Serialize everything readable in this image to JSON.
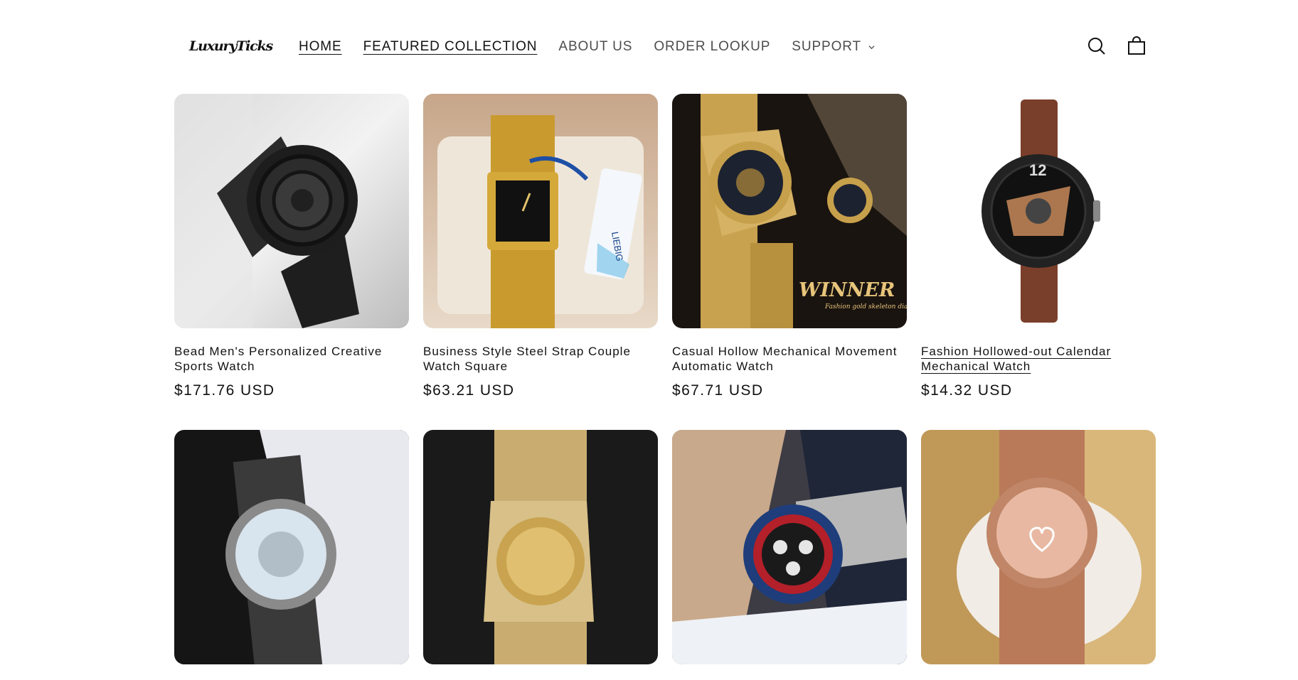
{
  "header": {
    "logo": "LuxuryTicks",
    "nav": [
      {
        "label": "HOME",
        "active": true
      },
      {
        "label": "FEATURED COLLECTION",
        "active": true
      },
      {
        "label": "ABOUT US",
        "active": false
      },
      {
        "label": "ORDER LOOKUP",
        "active": false
      },
      {
        "label": "SUPPORT",
        "active": false
      }
    ],
    "icons": [
      "search-icon",
      "cart-icon",
      "chevron-down-icon"
    ]
  },
  "products": [
    {
      "title": "Bead Men's Personalized Creative Sports Watch",
      "price": "$171.76 USD"
    },
    {
      "title": "Business Style Steel Strap Couple Watch Square",
      "price": "$63.21 USD"
    },
    {
      "title": "Casual Hollow Mechanical Movement Automatic Watch",
      "price": "$67.71 USD"
    },
    {
      "title": "Fashion Hollowed-out Calendar Mechanical Watch",
      "price": "$14.32 USD"
    },
    {
      "title": "",
      "price": ""
    },
    {
      "title": "",
      "price": ""
    },
    {
      "title": "",
      "price": ""
    },
    {
      "title": "",
      "price": ""
    }
  ],
  "image_text": {
    "winner": "WINNER",
    "winner_sub": "Fashion gold skeleton dial",
    "tag": "LIEBIG"
  }
}
